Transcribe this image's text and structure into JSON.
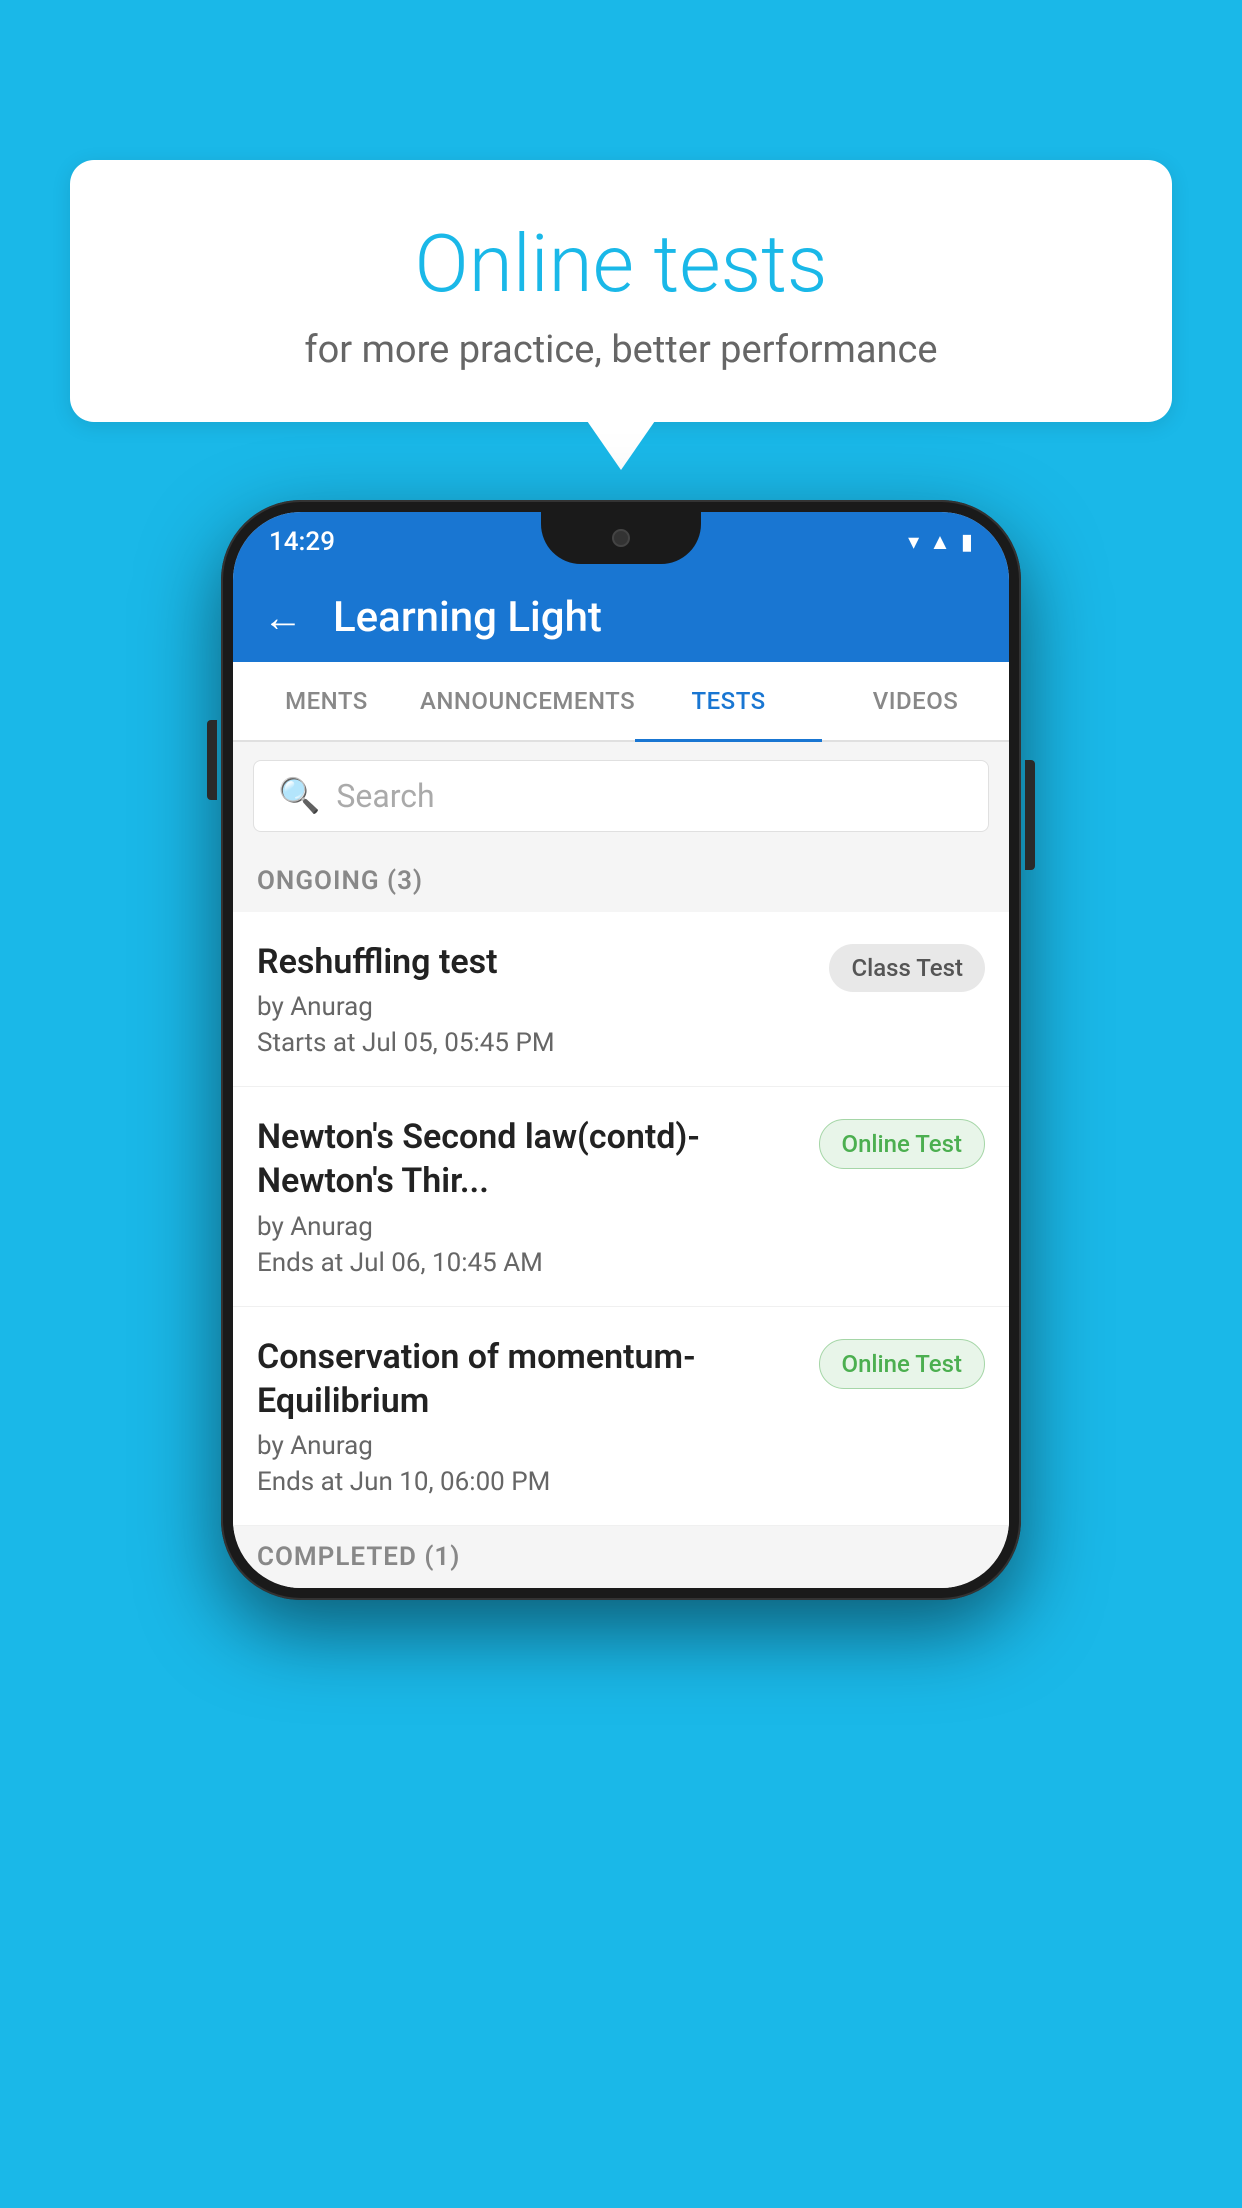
{
  "background": {
    "color": "#1ab8e8"
  },
  "speech_bubble": {
    "title": "Online tests",
    "subtitle": "for more practice, better performance"
  },
  "phone": {
    "status_bar": {
      "time": "14:29",
      "icons": [
        "wifi",
        "signal",
        "battery"
      ]
    },
    "header": {
      "back_label": "←",
      "title": "Learning Light"
    },
    "tabs": [
      {
        "label": "MENTS",
        "active": false
      },
      {
        "label": "ANNOUNCEMENTS",
        "active": false
      },
      {
        "label": "TESTS",
        "active": true
      },
      {
        "label": "VIDEOS",
        "active": false
      }
    ],
    "search": {
      "placeholder": "Search"
    },
    "ongoing_section": {
      "title": "ONGOING (3)"
    },
    "tests": [
      {
        "name": "Reshuffling test",
        "author": "by Anurag",
        "time_label": "Starts at  Jul 05, 05:45 PM",
        "badge": "Class Test",
        "badge_type": "class"
      },
      {
        "name": "Newton's Second law(contd)-Newton's Thir...",
        "author": "by Anurag",
        "time_label": "Ends at  Jul 06, 10:45 AM",
        "badge": "Online Test",
        "badge_type": "online"
      },
      {
        "name": "Conservation of momentum-Equilibrium",
        "author": "by Anurag",
        "time_label": "Ends at  Jun 10, 06:00 PM",
        "badge": "Online Test",
        "badge_type": "online"
      }
    ],
    "completed_section": {
      "title": "COMPLETED (1)"
    }
  }
}
